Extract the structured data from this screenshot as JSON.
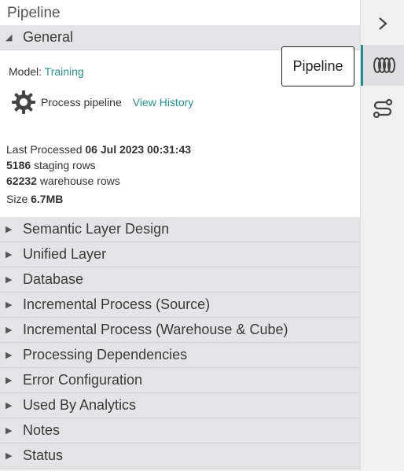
{
  "panel": {
    "title": "Pipeline"
  },
  "general": {
    "header": "General",
    "model_label": "Model:",
    "model_value": "Training",
    "process_label": "Process pipeline",
    "history_link": "View History",
    "last_processed_label": "Last Processed",
    "last_processed_value": "06 Jul 2023 00:31:43",
    "staging_count": "5186",
    "staging_label": "staging rows",
    "warehouse_count": "62232",
    "warehouse_label": "warehouse rows",
    "size_label": "Size",
    "size_value": "6.7MB"
  },
  "tooltip": "Pipeline",
  "sections": [
    "Semantic Layer Design",
    "Unified Layer",
    "Database",
    "Incremental Process (Source)",
    "Incremental Process (Warehouse & Cube)",
    "Processing Dependencies",
    "Error Configuration",
    "Used By Analytics",
    "Notes",
    "Status"
  ],
  "sidebar": {
    "collapse_icon": "chevron-right-icon",
    "pipeline_icon": "pipeline-icon",
    "flow_icon": "flow-icon"
  },
  "colors": {
    "accent": "#1e8e8e",
    "link": "#2d8c8c"
  }
}
